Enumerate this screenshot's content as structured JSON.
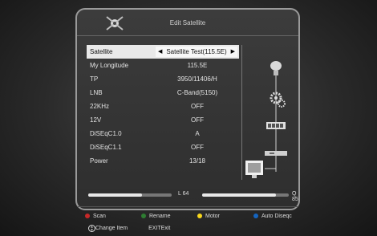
{
  "header": {
    "title": "Edit Satellite"
  },
  "menu": {
    "rows": [
      {
        "label": "Satellite",
        "value": "Satellite Test(115.5E)"
      },
      {
        "label": "My Longitude",
        "value": "115.5E"
      },
      {
        "label": "TP",
        "value": "3950/11406/H"
      },
      {
        "label": "LNB",
        "value": "C-Band(5150)"
      },
      {
        "label": "22KHz",
        "value": "OFF"
      },
      {
        "label": "12V",
        "value": "OFF"
      },
      {
        "label": "DiSEqC1.0",
        "value": "A"
      },
      {
        "label": "DiSEqC1.1",
        "value": "OFF"
      },
      {
        "label": "Power",
        "value": "13/18"
      }
    ]
  },
  "signal": {
    "level_label": "L 64",
    "level_value": 64,
    "quality_label": "Q 85",
    "quality_value": 85
  },
  "color_buttons": [
    {
      "label": "Scan",
      "color": "#c62828"
    },
    {
      "label": "Rename",
      "color": "#2e7d32"
    },
    {
      "label": "Motor",
      "color": "#f9d71c"
    },
    {
      "label": "Auto Diseqc",
      "color": "#1565c0"
    }
  ],
  "help": {
    "change_item": "Change Item",
    "exit_key": "EXIT",
    "exit_label": "Exit"
  }
}
